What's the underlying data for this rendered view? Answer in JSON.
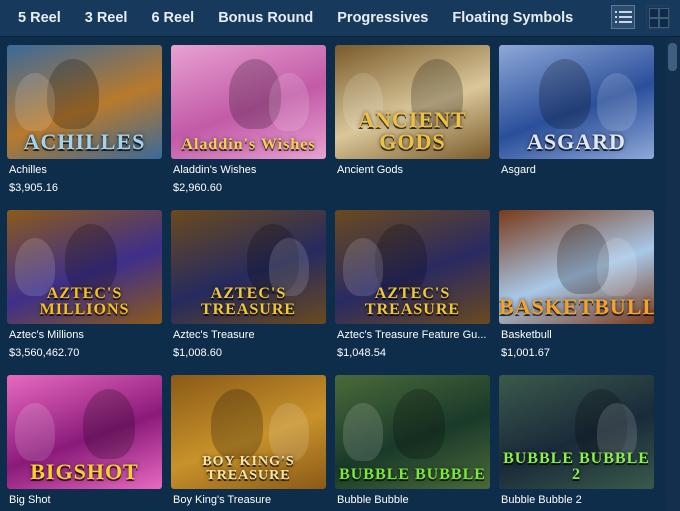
{
  "nav": {
    "tabs": [
      {
        "label": "5 Reel"
      },
      {
        "label": "3 Reel"
      },
      {
        "label": "6 Reel"
      },
      {
        "label": "Bonus Round"
      },
      {
        "label": "Progressives"
      },
      {
        "label": "Floating Symbols"
      }
    ],
    "list_view_icon": "list-view-icon",
    "grid_view_icon": "grid-view-icon"
  },
  "games": [
    {
      "name": "Achilles",
      "jackpot": "$3,905.16",
      "logo": "ACHILLES",
      "bg": "#b87a2c",
      "bg2": "#3a6a9a",
      "logo_color": "#9fd4f2"
    },
    {
      "name": "Aladdin's Wishes",
      "jackpot": "$2,960.60",
      "logo": "Aladdin's Wishes",
      "bg": "#c25aa8",
      "bg2": "#e8a2d0",
      "logo_color": "#f4d24a"
    },
    {
      "name": "Ancient Gods",
      "jackpot": "",
      "logo": "ANCIENT GODS",
      "bg": "#d9c79a",
      "bg2": "#7a5a2a",
      "logo_color": "#f0c040"
    },
    {
      "name": "Asgard",
      "jackpot": "",
      "logo": "ASGARD",
      "bg": "#2a4f9a",
      "bg2": "#8ea8d8",
      "logo_color": "#dfe8f6"
    },
    {
      "name": "Aztec's Millions",
      "jackpot": "$3,560,462.70",
      "logo": "AZTEC'S MILLIONS",
      "bg": "#3e2f8a",
      "bg2": "#8b5a1a",
      "logo_color": "#f4c21a"
    },
    {
      "name": "Aztec's Treasure",
      "jackpot": "$1,008.60",
      "logo": "AZTEC'S TREASURE",
      "bg": "#262a5e",
      "bg2": "#6a4a1e",
      "logo_color": "#f0c836"
    },
    {
      "name": "Aztec's Treasure Feature Gu...",
      "jackpot": "$1,048.54",
      "logo": "AZTEC'S TREASURE",
      "bg": "#2a2a62",
      "bg2": "#6a4a1e",
      "logo_color": "#f0c836"
    },
    {
      "name": "Basketbull",
      "jackpot": "$1,001.67",
      "logo": "BASKETBULL",
      "bg": "#a8c8e8",
      "bg2": "#7a3a1a",
      "logo_color": "#f4a22a"
    },
    {
      "name": "Big Shot",
      "jackpot": "",
      "logo": "BIGSHOT",
      "bg": "#8a1a7a",
      "bg2": "#e86ac0",
      "logo_color": "#f6d22a"
    },
    {
      "name": "Boy King's Treasure",
      "jackpot": "",
      "logo": "BOY KING'S TREASURE",
      "bg": "#c8922a",
      "bg2": "#8a5a18",
      "logo_color": "#f6e6a8"
    },
    {
      "name": "Bubble Bubble",
      "jackpot": "",
      "logo": "BUBBLE BUBBLE",
      "bg": "#1a3a2a",
      "bg2": "#4a6a3a",
      "logo_color": "#7ae83a"
    },
    {
      "name": "Bubble Bubble 2",
      "jackpot": "",
      "logo": "BUBBLE BUBBLE 2",
      "bg": "#1a2a3a",
      "bg2": "#3a5a4a",
      "logo_color": "#8af04a"
    }
  ]
}
